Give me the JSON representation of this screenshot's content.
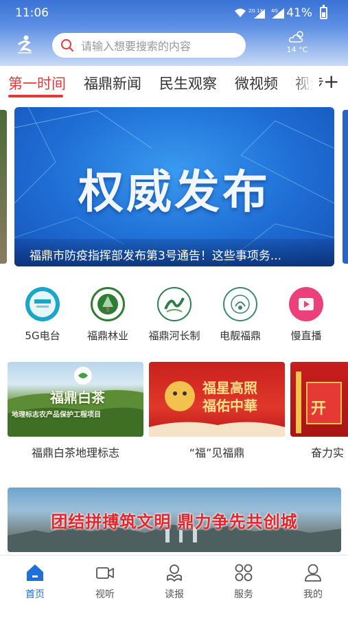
{
  "status_bar": {
    "time": "11:06",
    "battery": "41%",
    "network_labels": [
      "2G 1X",
      "4G"
    ]
  },
  "header": {
    "search_placeholder": "请输入想要搜索的内容",
    "weather": {
      "temperature": "14 °C",
      "icon": "cloudy-sun-icon"
    }
  },
  "tabs": [
    {
      "label": "第一时间",
      "active": true
    },
    {
      "label": "福鼎新闻",
      "active": false
    },
    {
      "label": "民生观察",
      "active": false
    },
    {
      "label": "微视频",
      "active": false
    },
    {
      "label": "视步",
      "active": false
    }
  ],
  "tab_add_label": "+",
  "banner": {
    "headline": "权威发布",
    "caption": "福鼎市防疫指挥部发布第3号通告！这些事项务..."
  },
  "services": [
    {
      "label": "5G电台",
      "icon": "5g-radio-icon",
      "color": "#1aa5c9"
    },
    {
      "label": "福鼎林业",
      "icon": "forestry-icon",
      "color": "#2f7d32"
    },
    {
      "label": "福鼎河长制",
      "icon": "river-chief-icon",
      "color": "#2e7d4f"
    },
    {
      "label": "电靓福鼎",
      "icon": "power-supply-icon",
      "color": "#3a8a6a"
    },
    {
      "label": "慢直播",
      "icon": "live-stream-icon",
      "color": "#ec407a"
    }
  ],
  "cards": [
    {
      "title": "福鼎白茶地理标志",
      "overlay": "福鼎白茶",
      "overlay_sub": "地理标志农产品保护工程项目"
    },
    {
      "title": "“福”见福鼎",
      "overlay": "福星高照",
      "overlay_sub": "福佑中華"
    },
    {
      "title": "奋力实",
      "overlay": "开"
    }
  ],
  "promo": {
    "text": "团结拼搏筑文明  鼎力争先共创城"
  },
  "bottom_nav": [
    {
      "label": "首页",
      "icon": "home-icon",
      "active": true
    },
    {
      "label": "视听",
      "icon": "video-camera-icon",
      "active": false
    },
    {
      "label": "读报",
      "icon": "newspaper-reader-icon",
      "active": false
    },
    {
      "label": "服务",
      "icon": "services-grid-icon",
      "active": false
    },
    {
      "label": "我的",
      "icon": "user-profile-icon",
      "active": false
    }
  ]
}
